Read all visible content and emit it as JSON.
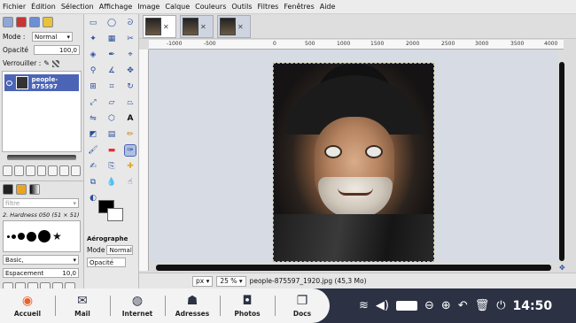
{
  "menubar": [
    "Fichier",
    "Édition",
    "Sélection",
    "Affichage",
    "Image",
    "Calque",
    "Couleurs",
    "Outils",
    "Filtres",
    "Fenêtres",
    "Aide"
  ],
  "layers": {
    "mode_label": "Mode :",
    "mode_value": "Normal",
    "opacity_label": "Opacité",
    "opacity_value": "100,0",
    "lock_label": "Verrouiller :",
    "layer_name": "people-875597"
  },
  "brushes": {
    "filter_placeholder": "filtre",
    "brush_name": "2. Hardness 050 (51 × 51)",
    "preset": "Basic,",
    "spacing_label": "Espacement",
    "spacing_value": "10,0"
  },
  "tool_options": {
    "tool_name": "Aérographe",
    "mode_label": "Mode",
    "mode_value": "Normal",
    "opacity_label": "Opacité"
  },
  "ruler": {
    "ticks": [
      "-1000",
      "-500",
      "0",
      "500",
      "1000",
      "1500",
      "2000",
      "2500",
      "3000",
      "3500",
      "4000"
    ]
  },
  "status": {
    "unit": "px",
    "zoom": "25 %",
    "file_info": "people-875597_1920.jpg (45,3 Mo)"
  },
  "dock": [
    {
      "label": "Accueil",
      "icon": "home-logo-icon"
    },
    {
      "label": "Mail",
      "icon": "mail-icon"
    },
    {
      "label": "Internet",
      "icon": "globe-icon"
    },
    {
      "label": "Adresses",
      "icon": "contacts-icon"
    },
    {
      "label": "Photos",
      "icon": "camera-icon"
    },
    {
      "label": "Docs",
      "icon": "documents-icon"
    }
  ],
  "tray": {
    "clock": "14:50"
  },
  "colors": {
    "accent": "#4b64b5",
    "taskbar": "#2c3244",
    "selection": "#d4c200"
  }
}
